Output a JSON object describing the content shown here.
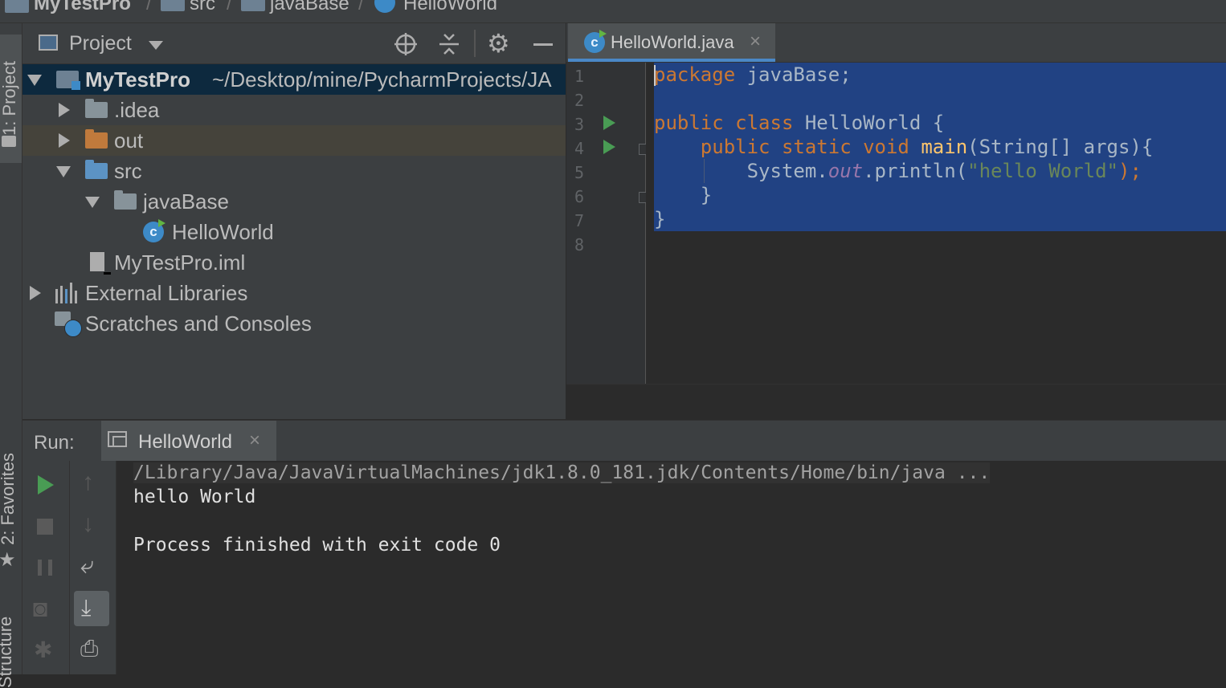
{
  "breadcrumb": {
    "items": [
      "MyTestPro",
      "src",
      "javaBase",
      "HelloWorld"
    ],
    "separator": "/"
  },
  "left_strip": {
    "tabs": [
      "1: Project",
      "2: Favorites",
      "Structure"
    ]
  },
  "project_panel": {
    "title": "Project",
    "tree": [
      {
        "label": "MyTestPro",
        "path": "~/Desktop/mine/PycharmProjects/JA"
      },
      {
        "label": ".idea"
      },
      {
        "label": "out"
      },
      {
        "label": "src"
      },
      {
        "label": "javaBase"
      },
      {
        "label": "HelloWorld"
      },
      {
        "label": "MyTestPro.iml"
      },
      {
        "label": "External Libraries"
      },
      {
        "label": "Scratches and Consoles"
      }
    ],
    "icons": [
      "target-icon",
      "collapse-all-icon",
      "gear-icon",
      "minimize-icon"
    ]
  },
  "editor": {
    "tab_label": "HelloWorld.java",
    "line_numbers": [
      "1",
      "2",
      "3",
      "4",
      "5",
      "6",
      "7",
      "8"
    ],
    "code": {
      "l1_kw": "package",
      "l1_rest": " javaBase;",
      "l3_kw": "public class",
      "l3_rest": " HelloWorld {",
      "l4_indent": "    ",
      "l4_kw": "public static void",
      "l4_sp": " ",
      "l4_fn": "main",
      "l4_rest": "(String[] args){",
      "l5_indent": "        ",
      "l5_pre": "System.",
      "l5_fld": "out",
      "l5_mid": ".println(",
      "l5_str": "\"hello World\"",
      "l5_end": ");",
      "l6": "    }",
      "l7": "}"
    }
  },
  "run": {
    "label": "Run:",
    "tab_label": "HelloWorld",
    "console": [
      "/Library/Java/JavaVirtualMachines/jdk1.8.0_181.jdk/Contents/Home/bin/java ...",
      "hello World",
      "Process finished with exit code 0"
    ]
  },
  "colors": {
    "accent": "#4a88c7",
    "selection": "#214283",
    "keyword": "#cc7832",
    "string": "#6a8759",
    "run_green": "#499c54"
  }
}
